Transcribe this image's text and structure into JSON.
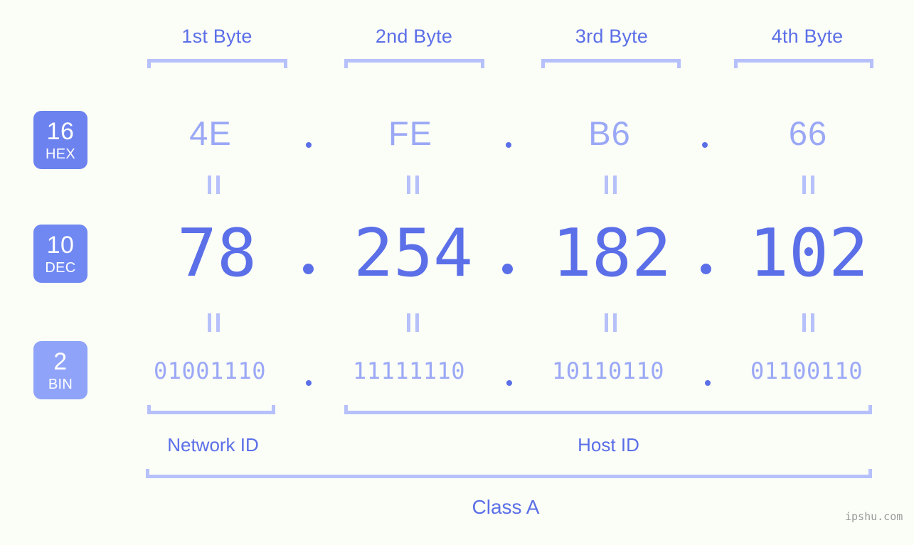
{
  "byte_headers": [
    {
      "label": "1st Byte"
    },
    {
      "label": "2nd Byte"
    },
    {
      "label": "3rd Byte"
    },
    {
      "label": "4th Byte"
    }
  ],
  "bases": [
    {
      "num": "16",
      "name": "HEX",
      "color": "#6c82ef"
    },
    {
      "num": "10",
      "name": "DEC",
      "color": "#7088f1"
    },
    {
      "num": "2",
      "name": "BIN",
      "color": "#8fa4f8"
    }
  ],
  "rows": {
    "hex": {
      "values": [
        "4E",
        "FE",
        "B6",
        "66"
      ],
      "separator": "."
    },
    "dec": {
      "values": [
        "78",
        "254",
        "182",
        "102"
      ],
      "separator": "."
    },
    "bin": {
      "values": [
        "01001110",
        "11111110",
        "10110110",
        "01100110"
      ],
      "separator": "."
    }
  },
  "equality_marks": {
    "symbol": "||",
    "count_per_row": 4
  },
  "segments": {
    "network_id": "Network ID",
    "host_id": "Host ID"
  },
  "class_label": "Class A",
  "watermark": "ipshu.com",
  "colors": {
    "background": "#fbfdf7",
    "accent_strong": "#5b6fe8",
    "accent_light": "#9aa8f6",
    "bracket": "#b6c1fb",
    "badge_dark": "#6c82ef",
    "badge_light": "#8fa4f8",
    "watermark": "#9a9a9a"
  }
}
